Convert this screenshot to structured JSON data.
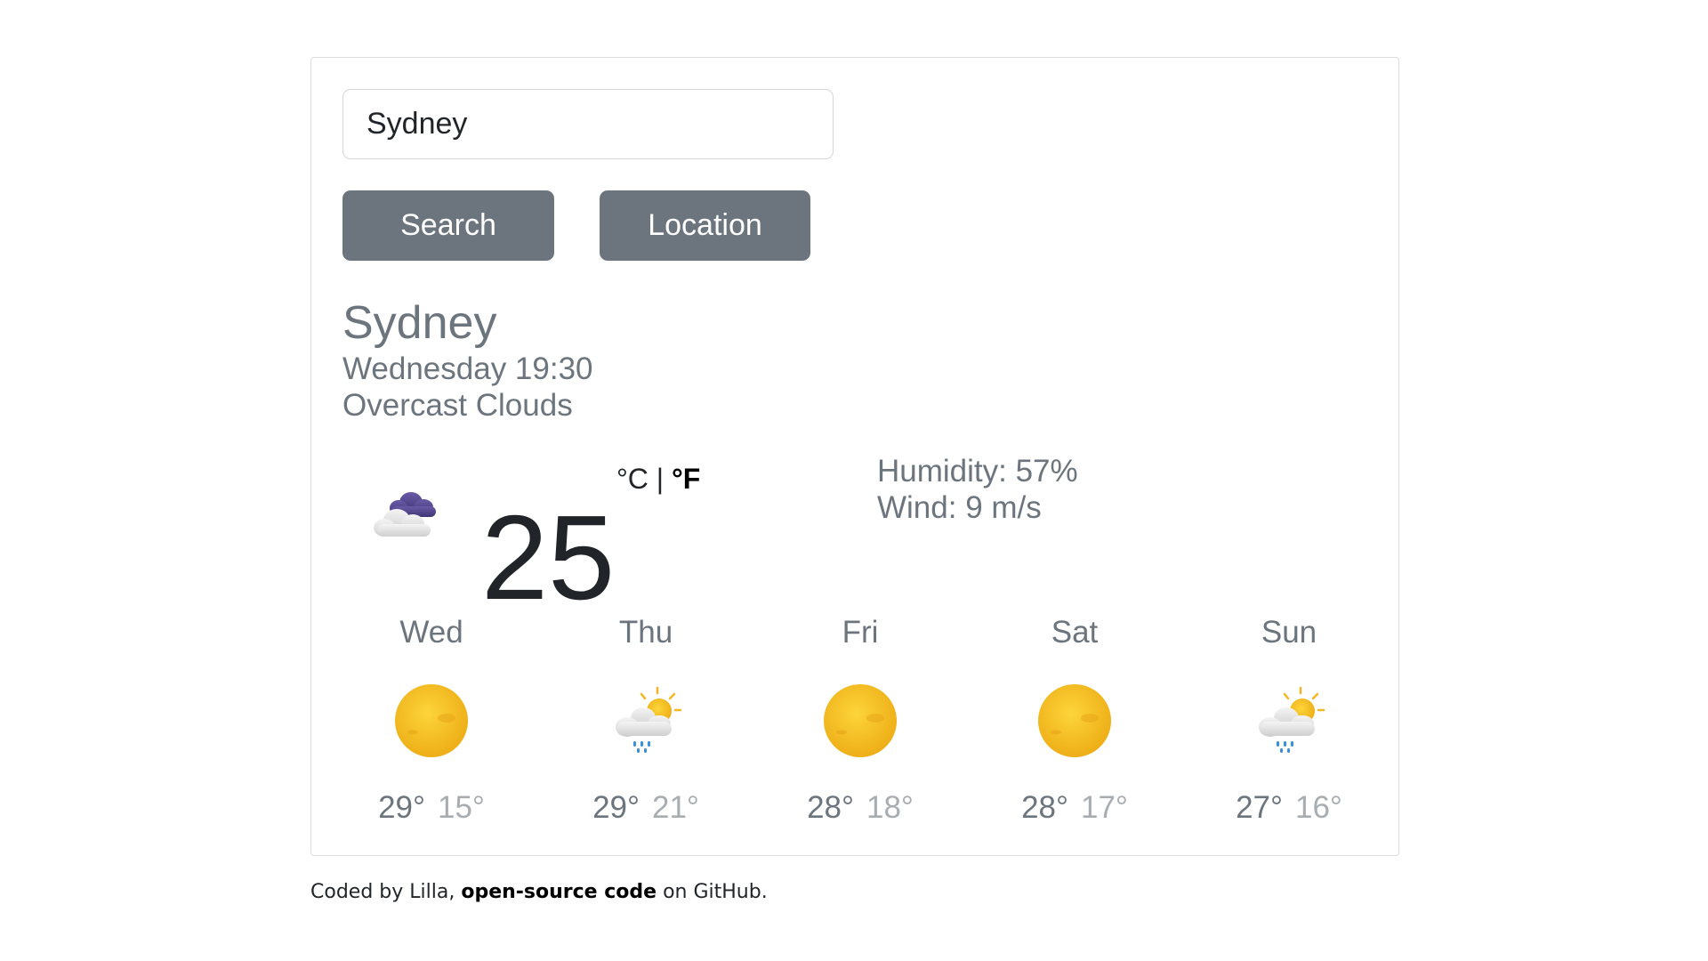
{
  "search": {
    "value": "Sydney",
    "search_label": "Search",
    "location_label": "Location"
  },
  "current": {
    "city": "Sydney",
    "datetime": "Wednesday 19:30",
    "description": "Overcast Clouds",
    "icon": "overcast-clouds-icon",
    "temperature": "25",
    "unit_c": "°C",
    "unit_sep": "|",
    "unit_f": "°F",
    "humidity": "Humidity: 57%",
    "wind": "Wind: 9 m/s"
  },
  "forecast": [
    {
      "day": "Wed",
      "icon": "sun-icon",
      "max": "29°",
      "min": "15°"
    },
    {
      "day": "Thu",
      "icon": "sun-cloud-rain-icon",
      "max": "29°",
      "min": "21°"
    },
    {
      "day": "Fri",
      "icon": "sun-icon",
      "max": "28°",
      "min": "18°"
    },
    {
      "day": "Sat",
      "icon": "sun-icon",
      "max": "28°",
      "min": "17°"
    },
    {
      "day": "Sun",
      "icon": "sun-cloud-rain-icon",
      "max": "27°",
      "min": "16°"
    }
  ],
  "footer": {
    "prefix": "Coded by Lilla, ",
    "link": "open-source code",
    "suffix": " on GitHub."
  },
  "colors": {
    "button": "#6c757d",
    "muted_text": "#6c757d",
    "sun": "#f2b824"
  }
}
